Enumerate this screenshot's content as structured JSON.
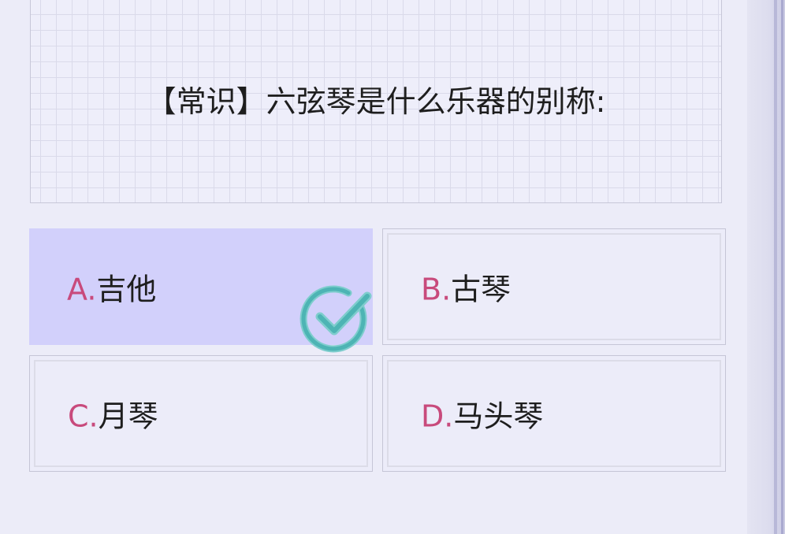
{
  "question": {
    "text": "【常识】六弦琴是什么乐器的别称:"
  },
  "options": [
    {
      "letter": "A.",
      "text": "吉他",
      "selected": true
    },
    {
      "letter": "B.",
      "text": "古琴",
      "selected": false
    },
    {
      "letter": "C.",
      "text": "月琴",
      "selected": false
    },
    {
      "letter": "D.",
      "text": "马头琴",
      "selected": false
    }
  ],
  "colors": {
    "letter": "#c84a7c",
    "selected_background": "#d2d0fb",
    "check_mark": "#4db4b4"
  },
  "icons": {
    "correct": "check-circle-icon"
  }
}
